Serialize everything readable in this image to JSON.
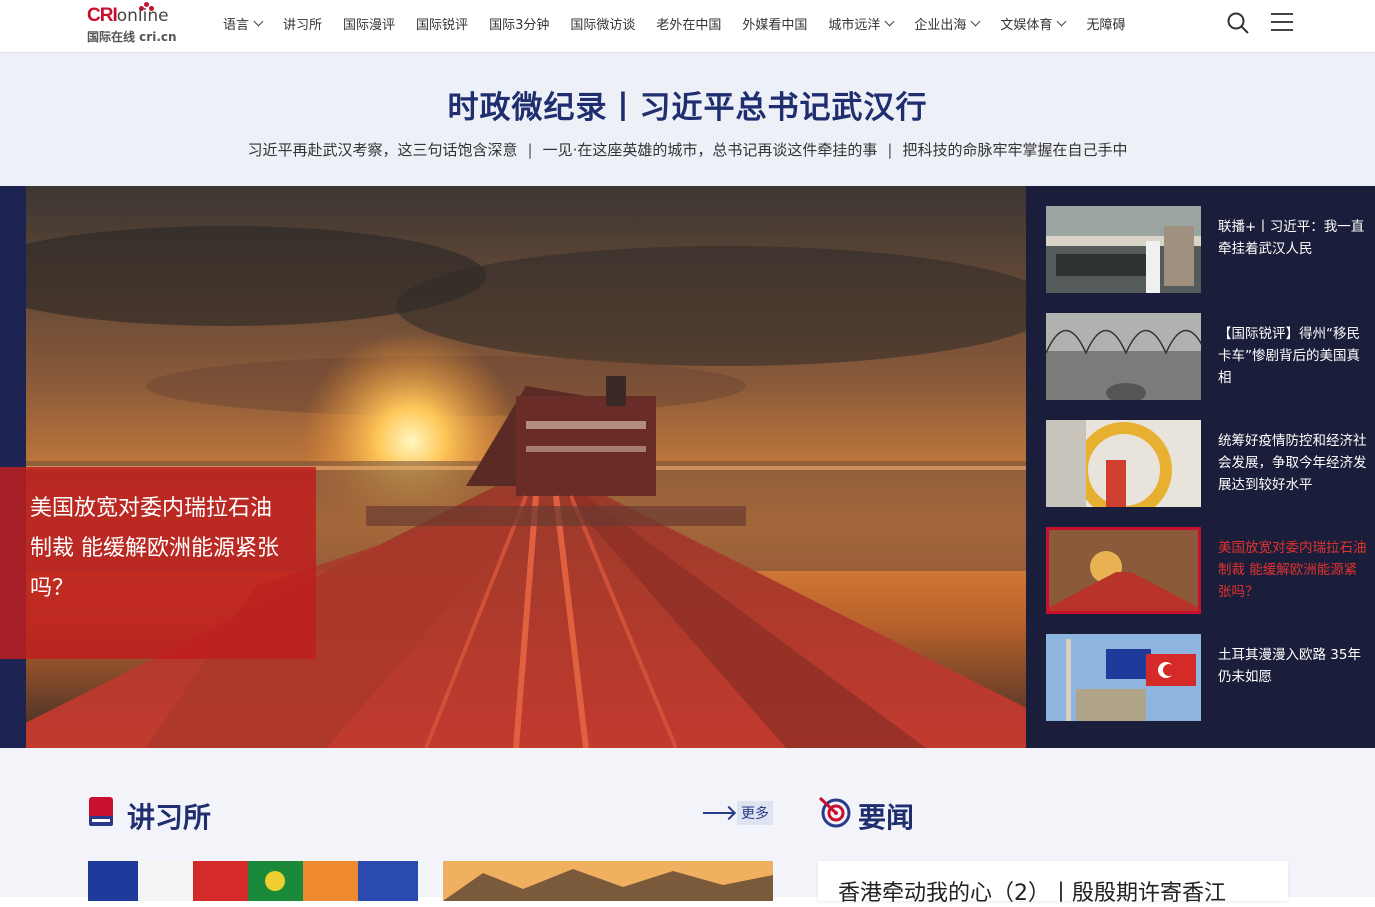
{
  "logo": {
    "brand_left": "CRI",
    "brand_right": "online",
    "subtitle": "国际在线 cri.cn"
  },
  "nav": {
    "items": [
      {
        "label": "语言",
        "dropdown": true
      },
      {
        "label": "讲习所",
        "dropdown": false
      },
      {
        "label": "国际漫评",
        "dropdown": false
      },
      {
        "label": "国际锐评",
        "dropdown": false
      },
      {
        "label": "国际3分钟",
        "dropdown": false
      },
      {
        "label": "国际微访谈",
        "dropdown": false
      },
      {
        "label": "老外在中国",
        "dropdown": false
      },
      {
        "label": "外媒看中国",
        "dropdown": false
      },
      {
        "label": "城市远洋",
        "dropdown": true
      },
      {
        "label": "企业出海",
        "dropdown": true
      },
      {
        "label": "文娱体育",
        "dropdown": true
      },
      {
        "label": "无障碍",
        "dropdown": false
      }
    ],
    "icons": {
      "search": "search-icon",
      "menu": "menu-icon"
    }
  },
  "headline": {
    "title": "时政微纪录丨习近平总书记武汉行",
    "links": [
      "习近平再赴武汉考察，这三句话饱含深意",
      "一见·在这座英雄的城市，总书记再谈这件牵挂的事",
      "把科技的命脉牢牢掌握在自己手中"
    ],
    "separator": "|"
  },
  "hero": {
    "caption": "美国放宽对委内瑞拉石油制裁 能缓解欧洲能源紧张吗？",
    "side_items": [
      {
        "text": "联播+丨习近平：我一直牵挂着武汉人民",
        "active": false
      },
      {
        "text": "【国际锐评】得州“移民卡车”惨剧背后的美国真相",
        "active": false
      },
      {
        "text": "统筹好疫情防控和经济社会发展，争取今年经济发展达到较好水平",
        "active": false
      },
      {
        "text": "美国放宽对委内瑞拉石油制裁 能缓解欧洲能源紧张吗？",
        "active": true
      },
      {
        "text": "土耳其漫漫入欧路 35年仍未如愿",
        "active": false
      }
    ]
  },
  "sections": {
    "left": {
      "title": "讲习所",
      "more": "更多",
      "icon": "book-icon"
    },
    "right": {
      "title": "要闻",
      "icon": "target-icon",
      "first_item": "香港牵动我的心（2）丨殷殷期许寄香江"
    }
  },
  "colors": {
    "accent_red": "#c8102e",
    "navy": "#1e2e6e",
    "hero_bg": "#1a1e3a"
  }
}
